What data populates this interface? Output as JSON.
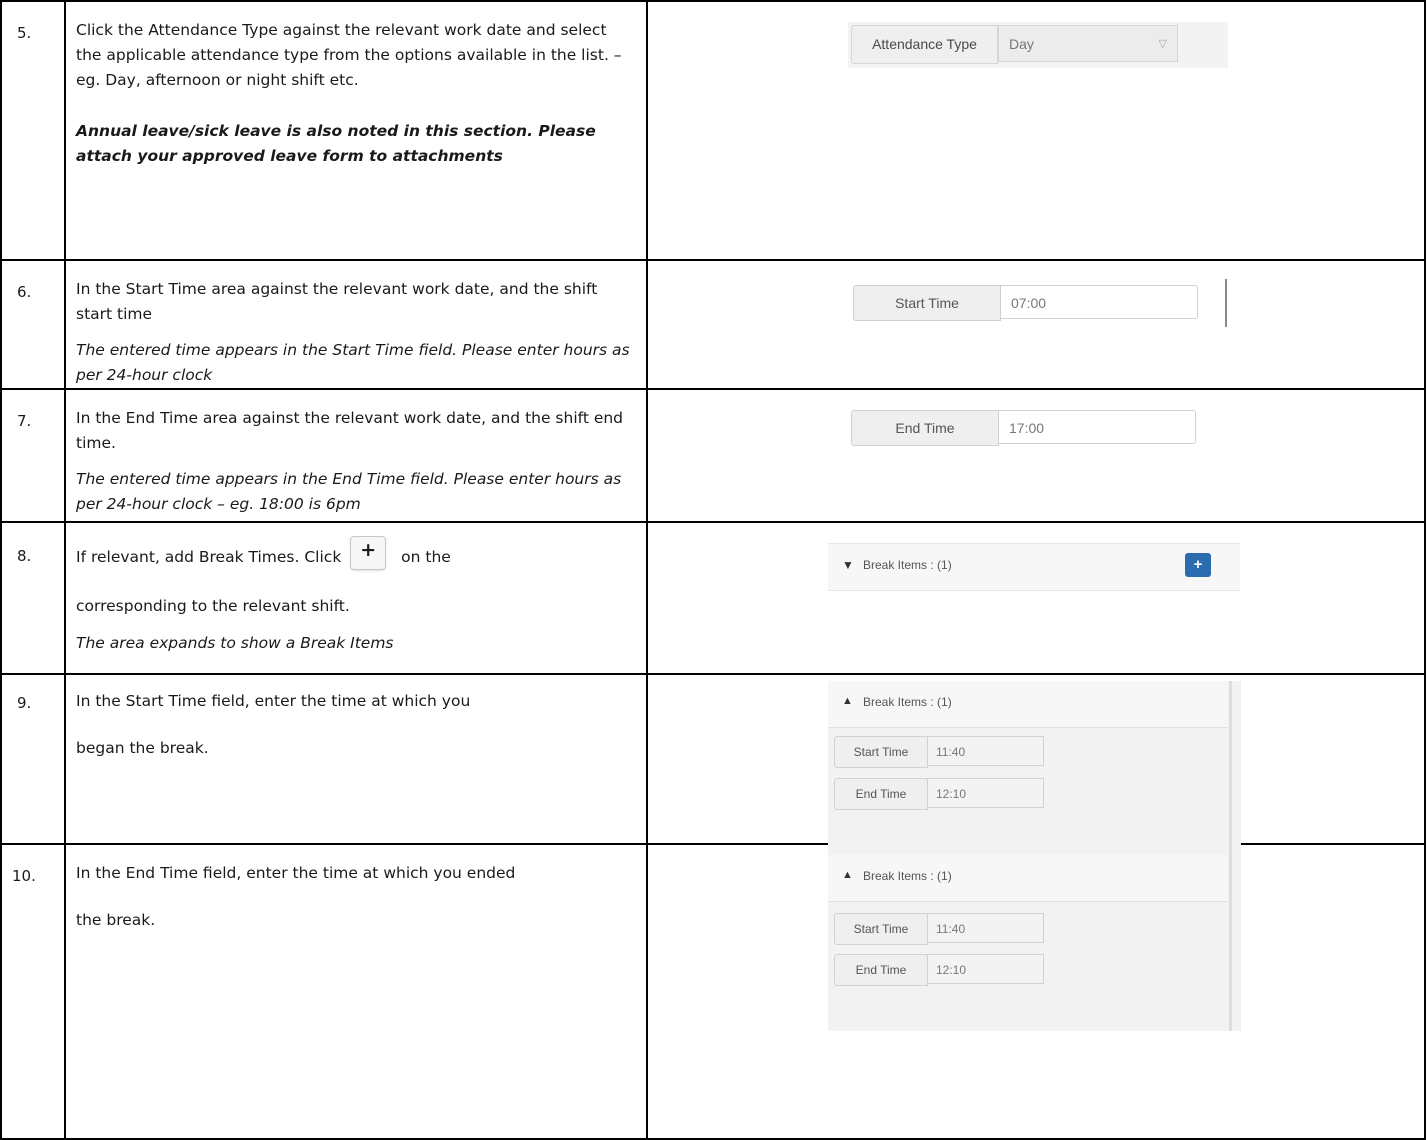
{
  "steps": [
    {
      "num": "5.",
      "text": "Click the Attendance Type against the relevant work date and select the applicable attendance type from the options available in the list. – eg. Day, afternoon or night shift etc.",
      "note": "Annual leave/sick leave is also noted in this section. Please attach your approved leave form to attachments",
      "widget": {
        "label": "Attendance Type",
        "value": "Day",
        "caret": "▽"
      }
    },
    {
      "num": "6.",
      "text": "In the Start Time area against the relevant work date, and the shift start time",
      "note": "The entered time appears in the Start Time field. Please enter hours as per 24-hour clock",
      "widget": {
        "label": "Start Time",
        "value": "07:00"
      }
    },
    {
      "num": "7.",
      "text": "In the End Time area against the relevant work date, and the shift end time.",
      "note": "The entered time appears in the End Time field. Please enter hours as per 24-hour clock – eg. 18:00 is 6pm",
      "widget": {
        "label": "End Time",
        "value": "17:00"
      }
    },
    {
      "num": "8.",
      "text_a": "If relevant, add Break Times. Click",
      "text_b": "on the",
      "text_c": "corresponding to the relevant shift.",
      "inline_icon": "+",
      "note": "The area expands to show a Break Items",
      "widget": {
        "label": "Break Items : (1)",
        "icon": "chevron-down-icon",
        "add": "+"
      }
    },
    {
      "num": "9.",
      "text_a": "In the Start Time field, enter the time at which you",
      "text_b": "began the break.",
      "widget": {
        "header": "Break Items : (1)",
        "start_label": "Start Time",
        "start_value": "11:40",
        "end_label": "End Time",
        "end_value": "12:10"
      }
    },
    {
      "num": "10.",
      "text_a": "In the End Time field, enter the time at which you ended",
      "text_b": "the break.",
      "widget": {
        "header": "Break Items : (1)",
        "start_label": "Start Time",
        "start_value": "11:40",
        "end_label": "End Time",
        "end_value": "12:10"
      }
    }
  ],
  "colors": {
    "accent": "#2b6cb0",
    "border": "#000000"
  }
}
